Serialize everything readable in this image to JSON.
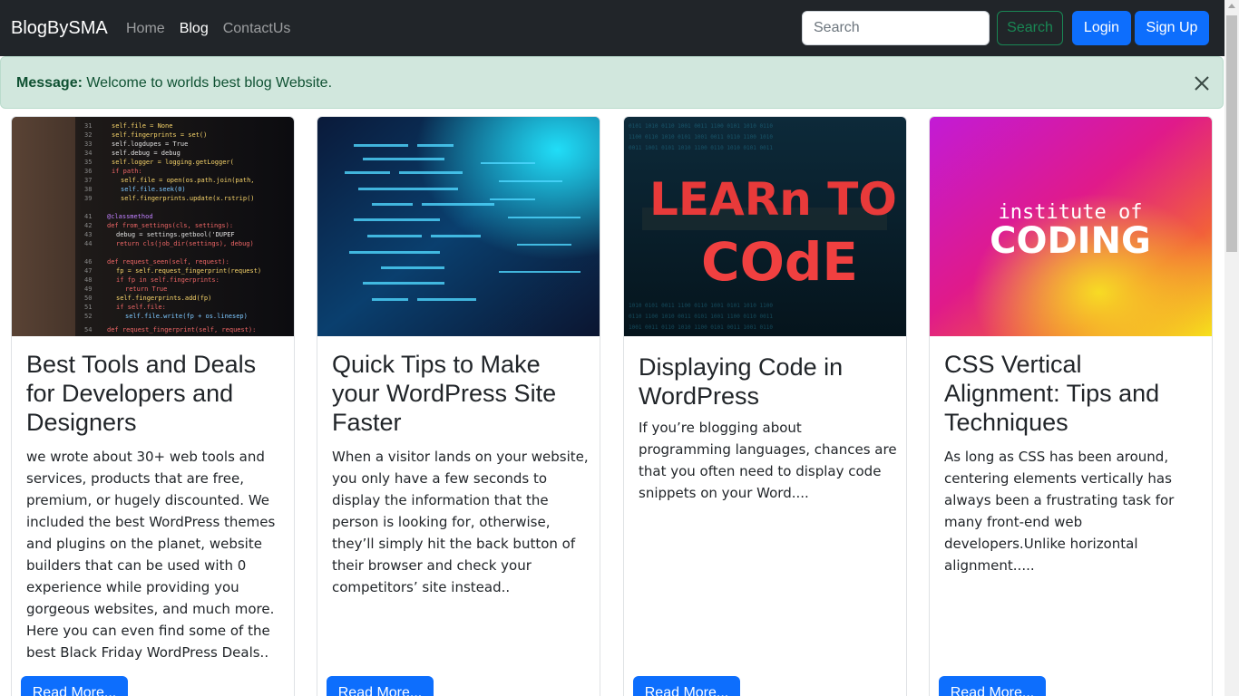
{
  "navbar": {
    "brand": "BlogBySMA",
    "links": [
      {
        "label": "Home",
        "active": false
      },
      {
        "label": "Blog",
        "active": true
      },
      {
        "label": "ContactUs",
        "active": false
      }
    ],
    "search_placeholder": "Search",
    "search_button": "Search",
    "login_button": "Login",
    "signup_button": "Sign Up"
  },
  "alert": {
    "label": "Message:",
    "text": " Welcome to worlds best blog Website.",
    "close_icon": "close-icon"
  },
  "cards": [
    {
      "image": "code-editor-screen-image",
      "title": "Best Tools and Deals for Developers and Designers",
      "text": "we wrote about 30+ web tools and services, products that are free, premium, or hugely discounted. We included the best WordPress themes and plugins on the planet, website builders that can be used with 0 experience while providing you gorgeous websites, and much more. Here you can even find some of the best Black Friday WordPress Deals..",
      "button": "Read More..."
    },
    {
      "image": "blue-code-screen-image",
      "title": "Quick Tips to Make your WordPress Site Faster",
      "text": "When a visitor lands on your website, you only have a few seconds to display the information that the person is looking for, otherwise, they’ll simply hit the back button of their browser and check your competitors’ site instead..",
      "button": "Read More..."
    },
    {
      "image": "learn-to-code-image",
      "image_text": [
        "LEARn TO",
        "COdE"
      ],
      "title": "Displaying Code in WordPress",
      "text": "If you’re blogging about programming languages, chances are that you often need to display code snippets on your Word....",
      "button": "Read More..."
    },
    {
      "image": "institute-of-coding-image",
      "image_text": [
        "institute of",
        "CODING"
      ],
      "title": "CSS Vertical Alignment: Tips and Techniques",
      "text": "As long as CSS has been around, centering elements vertically has always been a frustrating task for many front-end web developers.Unlike horizontal alignment.....",
      "button": "Read More..."
    }
  ],
  "colors": {
    "navbar_bg": "#212529",
    "alert_bg": "#d1e7dd",
    "alert_text": "#0f5132",
    "primary": "#0d6efd",
    "success": "#198754"
  }
}
